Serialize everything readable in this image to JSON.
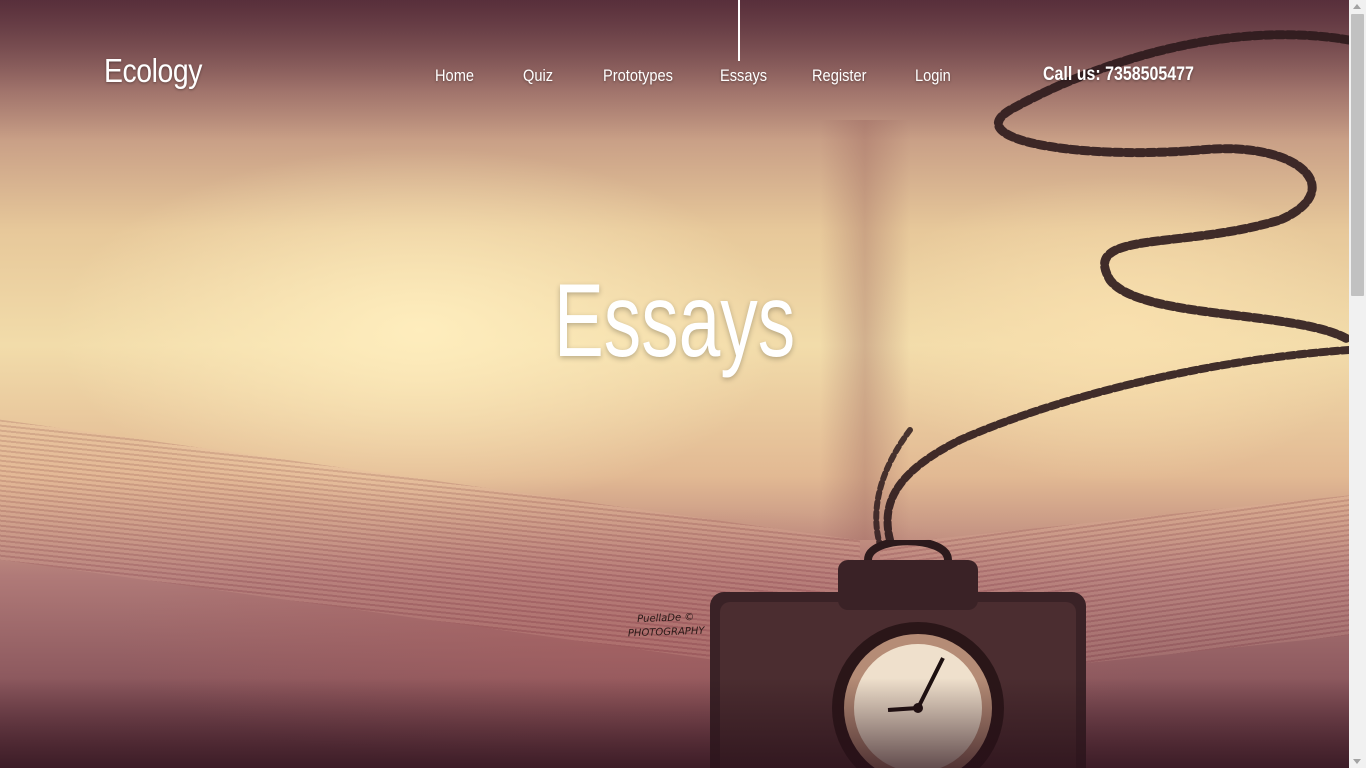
{
  "header": {
    "brand": "Ecology",
    "phone": "Call us: 7358505477"
  },
  "nav": {
    "items": [
      {
        "label": "Home"
      },
      {
        "label": "Quiz"
      },
      {
        "label": "Prototypes"
      },
      {
        "label": "Essays",
        "active": true
      },
      {
        "label": "Register"
      },
      {
        "label": "Login"
      }
    ]
  },
  "hero": {
    "title": "Essays",
    "watermark_line1": "PuellaDe ©",
    "watermark_line2": "PHOTOGRAPHY"
  },
  "colors": {
    "text": "#ffffff",
    "photo_tone": "#e7c89a",
    "scrollbar_track": "#f1f1f1",
    "scrollbar_thumb": "#c1c1c1"
  },
  "icons": {
    "scroll_up": "scroll-up-arrow-icon",
    "scroll_down": "scroll-down-arrow-icon"
  }
}
